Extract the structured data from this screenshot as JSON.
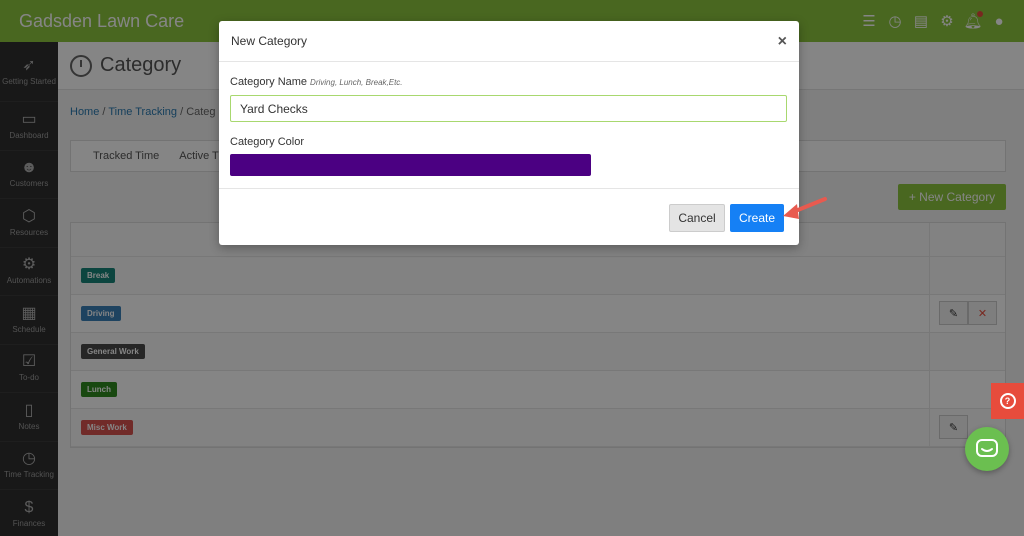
{
  "app": {
    "title": "Gadsden Lawn Care"
  },
  "topbar": {
    "icons": [
      "checklist-icon",
      "clock-icon",
      "chat-icon",
      "gear-icon",
      "bell-icon",
      "user-icon"
    ]
  },
  "sidebar": {
    "items": [
      {
        "label": "Getting Started",
        "icon": "rocket-icon"
      },
      {
        "label": "Dashboard",
        "icon": "monitor-icon"
      },
      {
        "label": "Customers",
        "icon": "users-icon"
      },
      {
        "label": "Resources",
        "icon": "box-icon"
      },
      {
        "label": "Automations",
        "icon": "gears-icon"
      },
      {
        "label": "Schedule",
        "icon": "calendar-icon"
      },
      {
        "label": "To-do",
        "icon": "checklist-icon"
      },
      {
        "label": "Notes",
        "icon": "clipboard-icon"
      },
      {
        "label": "Time Tracking",
        "icon": "clock-icon"
      },
      {
        "label": "Finances",
        "icon": "dollar-icon"
      }
    ]
  },
  "page": {
    "title": "Category",
    "breadcrumb": {
      "home": "Home",
      "sep1": "/",
      "time_tracking": "Time Tracking",
      "sep2": "/",
      "current": "Categ"
    },
    "tabs": [
      "Tracked Time",
      "Active Ti"
    ],
    "new_button": "+ New Category"
  },
  "table": {
    "rows": [
      {
        "label": "Break",
        "color": "#17857a"
      },
      {
        "label": "Driving",
        "color": "#3a80b8"
      },
      {
        "label": "General Work",
        "color": "#4a4a4a"
      },
      {
        "label": "Lunch",
        "color": "#2e8b1f"
      },
      {
        "label": "Misc Work",
        "color": "#d9534f"
      }
    ]
  },
  "modal": {
    "title": "New Category",
    "close": "×",
    "name_label": "Category Name",
    "name_hint": "Driving, Lunch, Break,Etc.",
    "name_value": "Yard Checks",
    "color_label": "Category Color",
    "color_value": "#4b0082",
    "cancel": "Cancel",
    "create": "Create"
  },
  "colors": {
    "brand": "#8cc63f",
    "primary": "#1580f5",
    "arrow": "#e85a4f",
    "help": "#e74c3c"
  }
}
